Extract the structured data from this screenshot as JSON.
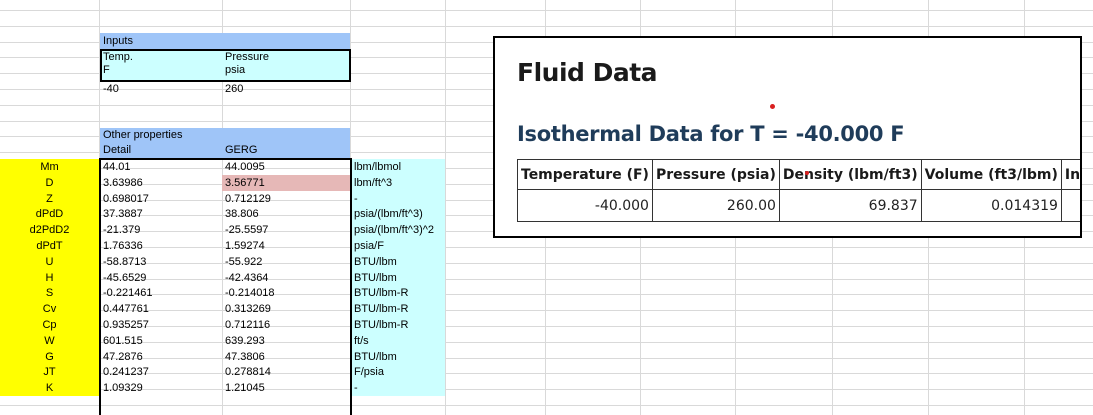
{
  "inputs": {
    "header": "Inputs",
    "temp_label": "Temp.",
    "temp_unit": "F",
    "pressure_label": "Pressure",
    "pressure_unit": "psia",
    "temp_value": "-40",
    "pressure_value": "260"
  },
  "other": {
    "header": "Other properties",
    "col_detail": "Detail",
    "col_gerg": "GERG"
  },
  "properties": [
    {
      "name": "Mm",
      "detail": "44.01",
      "gerg": "44.0095",
      "unit": "lbm/lbmol"
    },
    {
      "name": "D",
      "detail": "3.63986",
      "gerg": "3.56771",
      "unit": "lbm/ft^3"
    },
    {
      "name": "Z",
      "detail": "0.698017",
      "gerg": "0.712129",
      "unit": "-"
    },
    {
      "name": "dPdD",
      "detail": "37.3887",
      "gerg": "38.806",
      "unit": "psia/(lbm/ft^3)"
    },
    {
      "name": "d2PdD2",
      "detail": "-21.379",
      "gerg": "-25.5597",
      "unit": "psia/(lbm/ft^3)^2"
    },
    {
      "name": "dPdT",
      "detail": "1.76336",
      "gerg": "1.59274",
      "unit": "psia/F"
    },
    {
      "name": "U",
      "detail": "-58.8713",
      "gerg": "-55.922",
      "unit": "BTU/lbm"
    },
    {
      "name": "H",
      "detail": "-45.6529",
      "gerg": "-42.4364",
      "unit": "BTU/lbm"
    },
    {
      "name": "S",
      "detail": "-0.221461",
      "gerg": "-0.214018",
      "unit": "BTU/lbm-R"
    },
    {
      "name": "Cv",
      "detail": "0.447761",
      "gerg": "0.313269",
      "unit": "BTU/lbm-R"
    },
    {
      "name": "Cp",
      "detail": "0.935257",
      "gerg": "0.712116",
      "unit": "BTU/lbm-R"
    },
    {
      "name": "W",
      "detail": "601.515",
      "gerg": "639.293",
      "unit": "ft/s"
    },
    {
      "name": "G",
      "detail": "47.2876",
      "gerg": "47.3806",
      "unit": "BTU/lbm"
    },
    {
      "name": "JT",
      "detail": "0.241237",
      "gerg": "0.278814",
      "unit": "F/psia"
    },
    {
      "name": "K",
      "detail": "1.09329",
      "gerg": "1.21045",
      "unit": "-"
    }
  ],
  "card": {
    "title": "Fluid Data",
    "subtitle": "Isothermal Data for T = -40.000 F",
    "columns": [
      "Temperature (F)",
      "Pressure (psia)",
      "Density (lbm/ft3)",
      "Volume (ft3/lbm)",
      "Inte"
    ],
    "row": [
      "-40.000",
      "260.00",
      "69.837",
      "0.014319",
      ""
    ]
  },
  "colors": {
    "label_fill": "#ffff00",
    "header_fill": "#9fc5f8",
    "input_fill": "#ccffff",
    "highlight_fill": "#e6b8b7"
  }
}
